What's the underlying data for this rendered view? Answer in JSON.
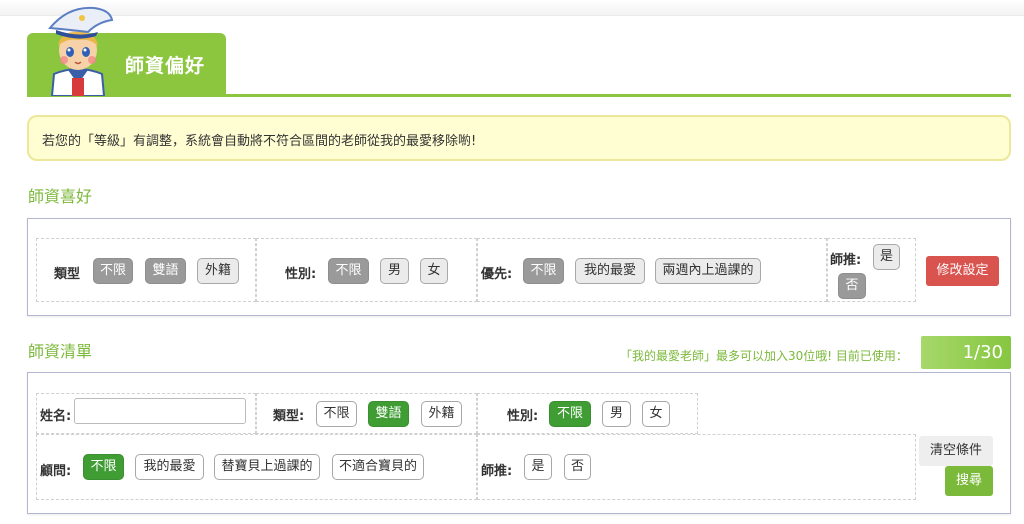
{
  "header": {
    "title": "師資偏好"
  },
  "notice": {
    "text": "若您的「等級」有調整，系統會自動將不符合區間的老師從我的最愛移除喲!"
  },
  "preferences": {
    "section_title": "師資喜好",
    "type": {
      "label": "類型",
      "options": [
        "不限",
        "雙語",
        "外籍"
      ],
      "selected": "不限"
    },
    "gender": {
      "label": "性別:",
      "options": [
        "不限",
        "男",
        "女"
      ],
      "selected": "不限"
    },
    "priority": {
      "label": "優先:",
      "options": [
        "不限",
        "我的最愛",
        "兩週內上過課的"
      ],
      "selected": "不限"
    },
    "recommend": {
      "label": "師推:",
      "options": [
        "是",
        "否"
      ],
      "selected": "否"
    },
    "edit_button": "修改設定"
  },
  "teacher_list": {
    "section_title": "師資清單",
    "favorite_note": "「我的最愛老師」最多可以加入30位哦! 目前已使用：",
    "favorite_count": "1/30",
    "name": {
      "label": "姓名:",
      "value": "",
      "placeholder": ""
    },
    "type": {
      "label": "類型:",
      "options": [
        "不限",
        "雙語",
        "外籍"
      ],
      "selected": "雙語"
    },
    "gender": {
      "label": "性別:",
      "options": [
        "不限",
        "男",
        "女"
      ],
      "selected": "不限"
    },
    "advisor": {
      "label": "顧問:",
      "options": [
        "不限",
        "我的最愛",
        "替寶貝上過課的",
        "不適合寶貝的"
      ],
      "selected": "不限"
    },
    "recommend": {
      "label": "師推:",
      "options": [
        "是",
        "否"
      ]
    },
    "clear_button": "清空條件",
    "search_button": "搜尋"
  },
  "colors": {
    "accent": "#8cc63f",
    "selected_green": "#3f9d34",
    "danger": "#d9534f",
    "notice_bg": "#fffdd2"
  },
  "icons": {
    "mascot": "sailor-mascot-icon"
  }
}
